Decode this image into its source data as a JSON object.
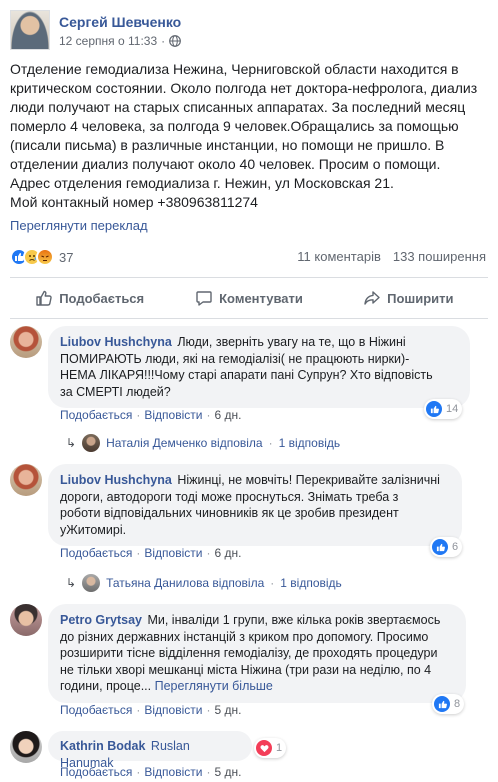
{
  "post": {
    "author": "Сергей Шевченко",
    "date": "12 серпня о 11:33",
    "visibility_icon": "globe-icon",
    "text_lines": [
      "Отделение гемодиализа Нежина, Черниговской области находится в",
      "критическом состоянии. Около полгода нет доктора-нефролога, диализ",
      "люди получают на старых списанных аппаратах. За последний месяц",
      "померло 4 человека, за полгода 9 человек.Обращались за помощью",
      "(писали письма) в различные инстанции, но помощи не пришло. В",
      "отделении диализ получают около 40 человек. Просим о помощи.",
      "Адрес отделения гемодиализа г. Нежин, ул Московская 21.",
      "Мой контакный номер +380963811274"
    ],
    "see_translation": "Переглянути переклад",
    "reaction_count": "37",
    "comments_count": "11 коментарів",
    "shares_count": "133 поширення"
  },
  "actions": {
    "like": "Подобається",
    "comment": "Коментувати",
    "share": "Поширити"
  },
  "comments": [
    {
      "name": "Liubov Hushchyna",
      "text_lines": [
        "Люди, зверніть увагу на те, що в Ніжині",
        "ПОМИРАЮТЬ люди, які на гемодіалізі( не працюють нирки)-",
        "НЕМА ЛІКАРЯ!!!Чому старі апарати пані Супрун? Хто відповість",
        "за СМЕРТІ людей?"
      ],
      "like": "Подобається",
      "reply": "Відповісти",
      "age": "6 дн.",
      "reactions": "14",
      "reply_author": "Наталія Демченко відповіла",
      "reply_count": "1 відповідь"
    },
    {
      "name": "Liubov Hushchyna",
      "text_lines": [
        "Ніжинці, не мовчіть! Перекривайте залізничні",
        "дороги, автодороги тоді може проснуться. Знімать треба з",
        "роботи відповідальних чиновників як це зробив президент",
        "уЖитомирі."
      ],
      "like": "Подобається",
      "reply": "Відповісти",
      "age": "6 дн.",
      "reactions": "6",
      "reply_author": "Татьяна Данилова відповіла",
      "reply_count": "1 відповідь"
    },
    {
      "name": "Petro Grytsay",
      "text_lines": [
        "Ми, інваліди 1 групи, вже кілька років звертаємось",
        "до різних державних інстанцій з криком про допомогу. Просимо",
        "розширити тісне відділення гемодіалізу, де проходять процедури",
        "не тільки хворі мешканці міста Ніжина (три рази на неділю, по 4",
        "години, проце..."
      ],
      "see_more": "Переглянути більше",
      "like": "Подобається",
      "reply": "Відповісти",
      "age": "5 дн.",
      "reactions": "8"
    },
    {
      "name": "Kathrin Bodak",
      "tag": "Ruslan Hanumak",
      "like": "Подобається",
      "reply": "Відповісти",
      "age": "5 дн.",
      "reactions": "1"
    }
  ]
}
